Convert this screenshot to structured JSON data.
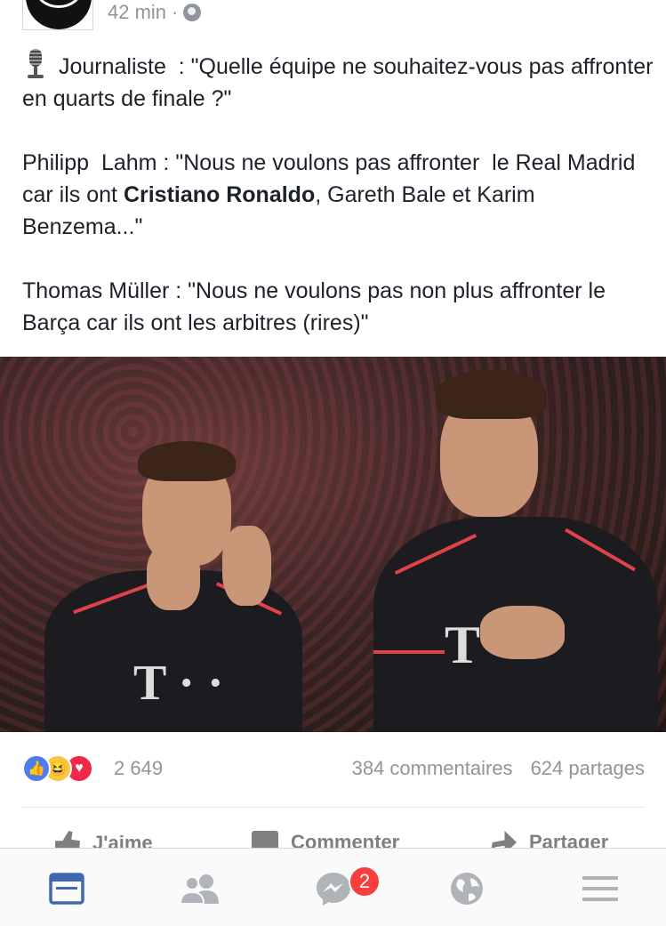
{
  "post": {
    "time": "42 min",
    "audience_icon": "globe-icon",
    "paragraphs": {
      "p1": " Journaliste  : \"Quelle équipe ne souhaitez-vous pas affronter en quarts de finale ?\"",
      "p2_start": "Philipp  Lahm : \"Nous ne voulons pas affronter  le Real Madrid car ils ont ",
      "p2_bold": "Cristiano Ronaldo",
      "p2_end": ", Gareth Bale et Karim Benzema...\"",
      "p3": "Thomas Müller : \"Nous ne voulons pas non plus affronter le Barça car ils ont les arbitres (rires)\""
    },
    "image_icon": "photo-players"
  },
  "reactions": {
    "icons": [
      "like-reaction-icon",
      "haha-reaction-icon",
      "love-reaction-icon"
    ],
    "count": "2 649",
    "comments": "384 commentaires",
    "shares": "624 partages"
  },
  "actions": {
    "like": "J'aime",
    "comment": "Commenter",
    "share": "Partager"
  },
  "tabbar": {
    "items": [
      "news-feed-icon",
      "friends-icon",
      "messenger-icon",
      "notifications-globe-icon",
      "menu-icon"
    ],
    "messenger_badge": "2"
  },
  "colors": {
    "accent": "#4267b2",
    "badge": "#fa3e3e",
    "muted": "#90949c"
  }
}
